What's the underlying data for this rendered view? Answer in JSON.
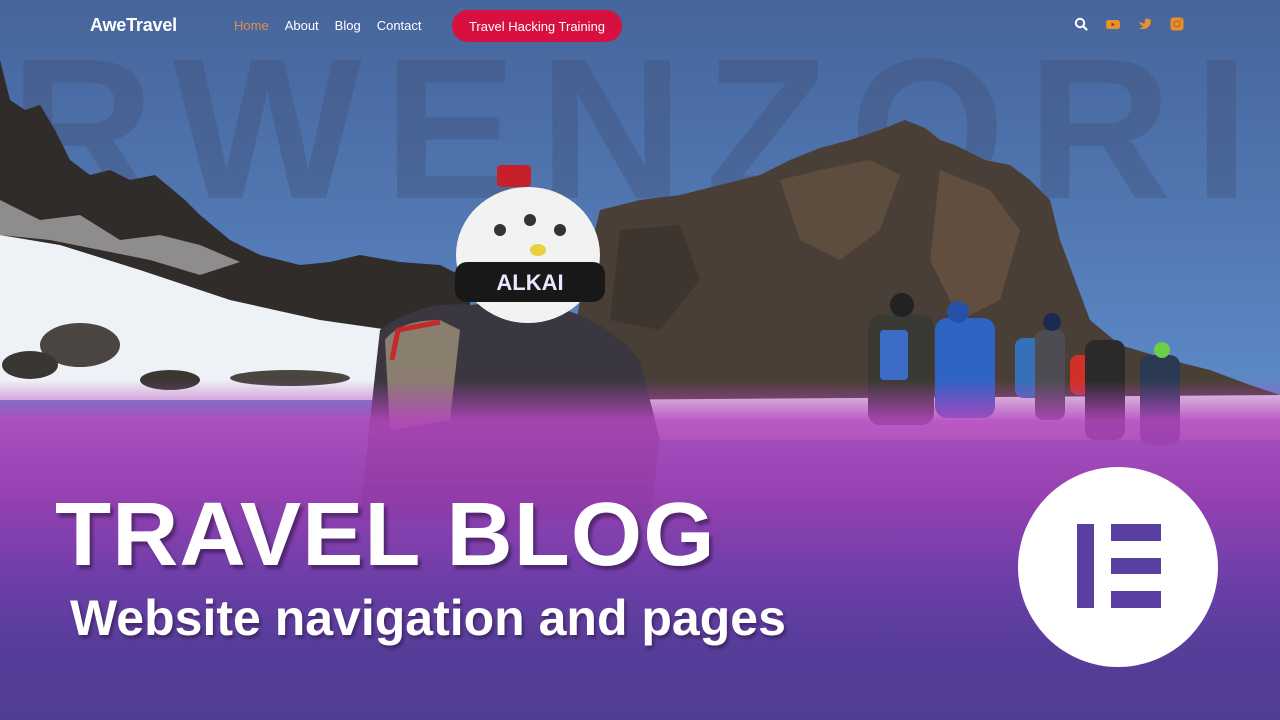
{
  "site": {
    "logo": "AweTravel",
    "menu": [
      {
        "label": "Home",
        "active": true
      },
      {
        "label": "About",
        "active": false
      },
      {
        "label": "Blog",
        "active": false
      },
      {
        "label": "Contact",
        "active": false
      }
    ],
    "cta_label": "Travel Hacking Training",
    "header_icons": [
      "search-icon",
      "youtube-icon",
      "twitter-icon",
      "instagram-icon"
    ]
  },
  "hero": {
    "watermark": "RWENZORI",
    "helmet_text": "ALKAI"
  },
  "thumbnail": {
    "title": "TRAVEL BLOG",
    "subtitle": "Website navigation and pages",
    "badge_icon": "elementor-logo-icon"
  },
  "colors": {
    "accent_cta": "#d8103f",
    "active_menu": "#e0904a",
    "social_icons": "#e8902e",
    "overlay_purple": "#553d98",
    "badge_mark": "#5b3ea2"
  }
}
